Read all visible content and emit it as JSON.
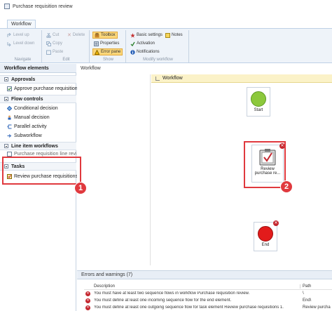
{
  "window": {
    "title": "Purchase requisition review"
  },
  "ribbon": {
    "tab": "Workflow",
    "navigate": {
      "label": "Navigate",
      "level_up": "Level up",
      "level_down": "Level down"
    },
    "edit": {
      "label": "Edit",
      "cut": "Cut",
      "delete": "Delete",
      "copy": "Copy",
      "paste": "Paste"
    },
    "show": {
      "label": "Show",
      "toolbox": "Toolbox",
      "properties": "Properties",
      "error_pane": "Error pane"
    },
    "modify": {
      "label": "Modify workflow",
      "basic_settings": "Basic settings",
      "notes": "Notes",
      "activation": "Activation",
      "notifications": "Notifications"
    }
  },
  "toolbox": {
    "header": "Workflow elements",
    "approvals": {
      "title": "Approvals",
      "items": [
        "Approve purchase requisitions"
      ]
    },
    "flow_controls": {
      "title": "Flow controls",
      "items": [
        "Conditional decision",
        "Manual decision",
        "Parallel activity",
        "Subworkflow"
      ]
    },
    "line_item": {
      "title": "Line item workflows",
      "items": [
        "Purchase requisition line revi"
      ]
    },
    "tasks": {
      "title": "Tasks",
      "items": [
        "Review purchase requisitions"
      ]
    }
  },
  "designer": {
    "pane_title": "Workflow",
    "header": "Workflow",
    "start_label": "Start",
    "task_label": "Review purchase re...",
    "end_label": "End"
  },
  "callouts": {
    "one": "1",
    "two": "2"
  },
  "errors": {
    "header": "Errors and warnings (7)",
    "col_description": "Description",
    "col_path": "Path",
    "rows": [
      {
        "description": "You must have at least two sequence flows in workflow Purchase requisition review.",
        "path": "\\"
      },
      {
        "description": "You must define at least one incoming sequence flow for the end element.",
        "path": "End\\"
      },
      {
        "description": "You must define at least one outgoing sequence flow for task element Review purchase requisitions 1.",
        "path": "Review purcha"
      }
    ]
  },
  "colors": {
    "accent_red": "#e0393e",
    "start_green": "#8cc83c",
    "end_red": "#e21b1b",
    "toolbar_active": "#fbd77a"
  }
}
